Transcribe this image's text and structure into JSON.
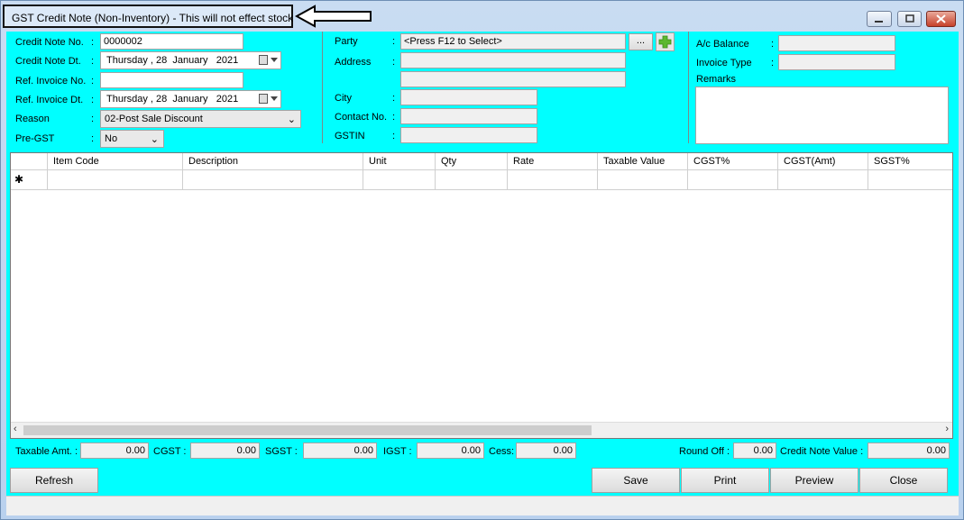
{
  "window": {
    "title": "GST Credit Note (Non-Inventory) - This will not effect stock"
  },
  "header": {
    "credit_note_no": {
      "label": "Credit Note No.",
      "value": "0000002"
    },
    "credit_note_dt": {
      "label": "Credit Note Dt.",
      "day": "Thursday",
      "date": ", 28",
      "month": "January",
      "year": "2021"
    },
    "ref_invoice_no": {
      "label": "Ref. Invoice No.",
      "value": ""
    },
    "ref_invoice_dt": {
      "label": "Ref. Invoice Dt.",
      "day": "Thursday",
      "date": ", 28",
      "month": "January",
      "year": "2021"
    },
    "reason": {
      "label": "Reason",
      "value": "02-Post Sale Discount"
    },
    "pre_gst": {
      "label": "Pre-GST",
      "value": "No"
    },
    "party": {
      "label": "Party",
      "value": "<Press F12 to Select>",
      "browse_label": "..."
    },
    "address": {
      "label": "Address"
    },
    "city": {
      "label": "City"
    },
    "contact_no": {
      "label": "Contact No."
    },
    "gstin": {
      "label": "GSTIN"
    },
    "ac_balance": {
      "label": "A/c Balance"
    },
    "invoice_type": {
      "label": "Invoice Type"
    },
    "remarks": {
      "label": "Remarks"
    },
    "colon": ":"
  },
  "grid": {
    "columns": [
      "Item Code",
      "Description",
      "Unit",
      "Qty",
      "Rate",
      "Taxable Value",
      "CGST%",
      "CGST(Amt)",
      "SGST%"
    ],
    "new_row_marker": "✱"
  },
  "totals": {
    "taxable_amt": {
      "label": "Taxable Amt. :",
      "value": "0.00"
    },
    "cgst": {
      "label": "CGST :",
      "value": "0.00"
    },
    "sgst": {
      "label": "SGST :",
      "value": "0.00"
    },
    "igst": {
      "label": "IGST :",
      "value": "0.00"
    },
    "cess": {
      "label": "Cess:",
      "value": "0.00"
    },
    "round_off": {
      "label": "Round Off :",
      "value": "0.00"
    },
    "credit_note_value": {
      "label": "Credit Note Value :",
      "value": "0.00"
    }
  },
  "buttons": {
    "refresh": "Refresh",
    "save": "Save",
    "print": "Print",
    "preview": "Preview",
    "close": "Close"
  },
  "colors": {
    "client_bg": "#00ffff",
    "title_bg": "#dce9f8"
  }
}
